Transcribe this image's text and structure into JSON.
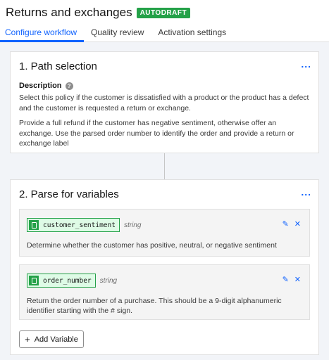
{
  "header": {
    "title": "Returns and exchanges",
    "badge": "AUTODRAFT"
  },
  "tabs": [
    {
      "label": "Configure workflow",
      "active": true
    },
    {
      "label": "Quality review",
      "active": false
    },
    {
      "label": "Activation settings",
      "active": false
    }
  ],
  "path_selection": {
    "title": "1. Path selection",
    "overflow_icon": "...",
    "description_label": "Description",
    "help_icon": "?",
    "paragraphs": [
      "Select this policy if the customer is dissatisfied with a product or the product has a defect and the customer is requested a return or exchange.",
      "Provide a full refund if the customer has negative sentiment, otherwise offer an exchange. Use the parsed order number to identify the order and provide a return or exchange label"
    ]
  },
  "parse_variables": {
    "title": "2. Parse for variables",
    "overflow_icon": "...",
    "variables": [
      {
        "name": "customer_sentiment",
        "type": "string",
        "description": "Determine whether the customer has positive, neutral, or negative sentiment"
      },
      {
        "name": "order_number",
        "type": "string",
        "description": "Return the order number of a purchase. This should be a 9-digit alphanumeric identifier starting with the # sign."
      }
    ],
    "add_button": {
      "icon": "+",
      "label": "Add Variable"
    },
    "edit_icon": "✎",
    "delete_icon": "✕"
  },
  "colors": {
    "accent": "#0f62fe",
    "badge": "#24a148",
    "variable_tag_bg": "#defbe6"
  }
}
